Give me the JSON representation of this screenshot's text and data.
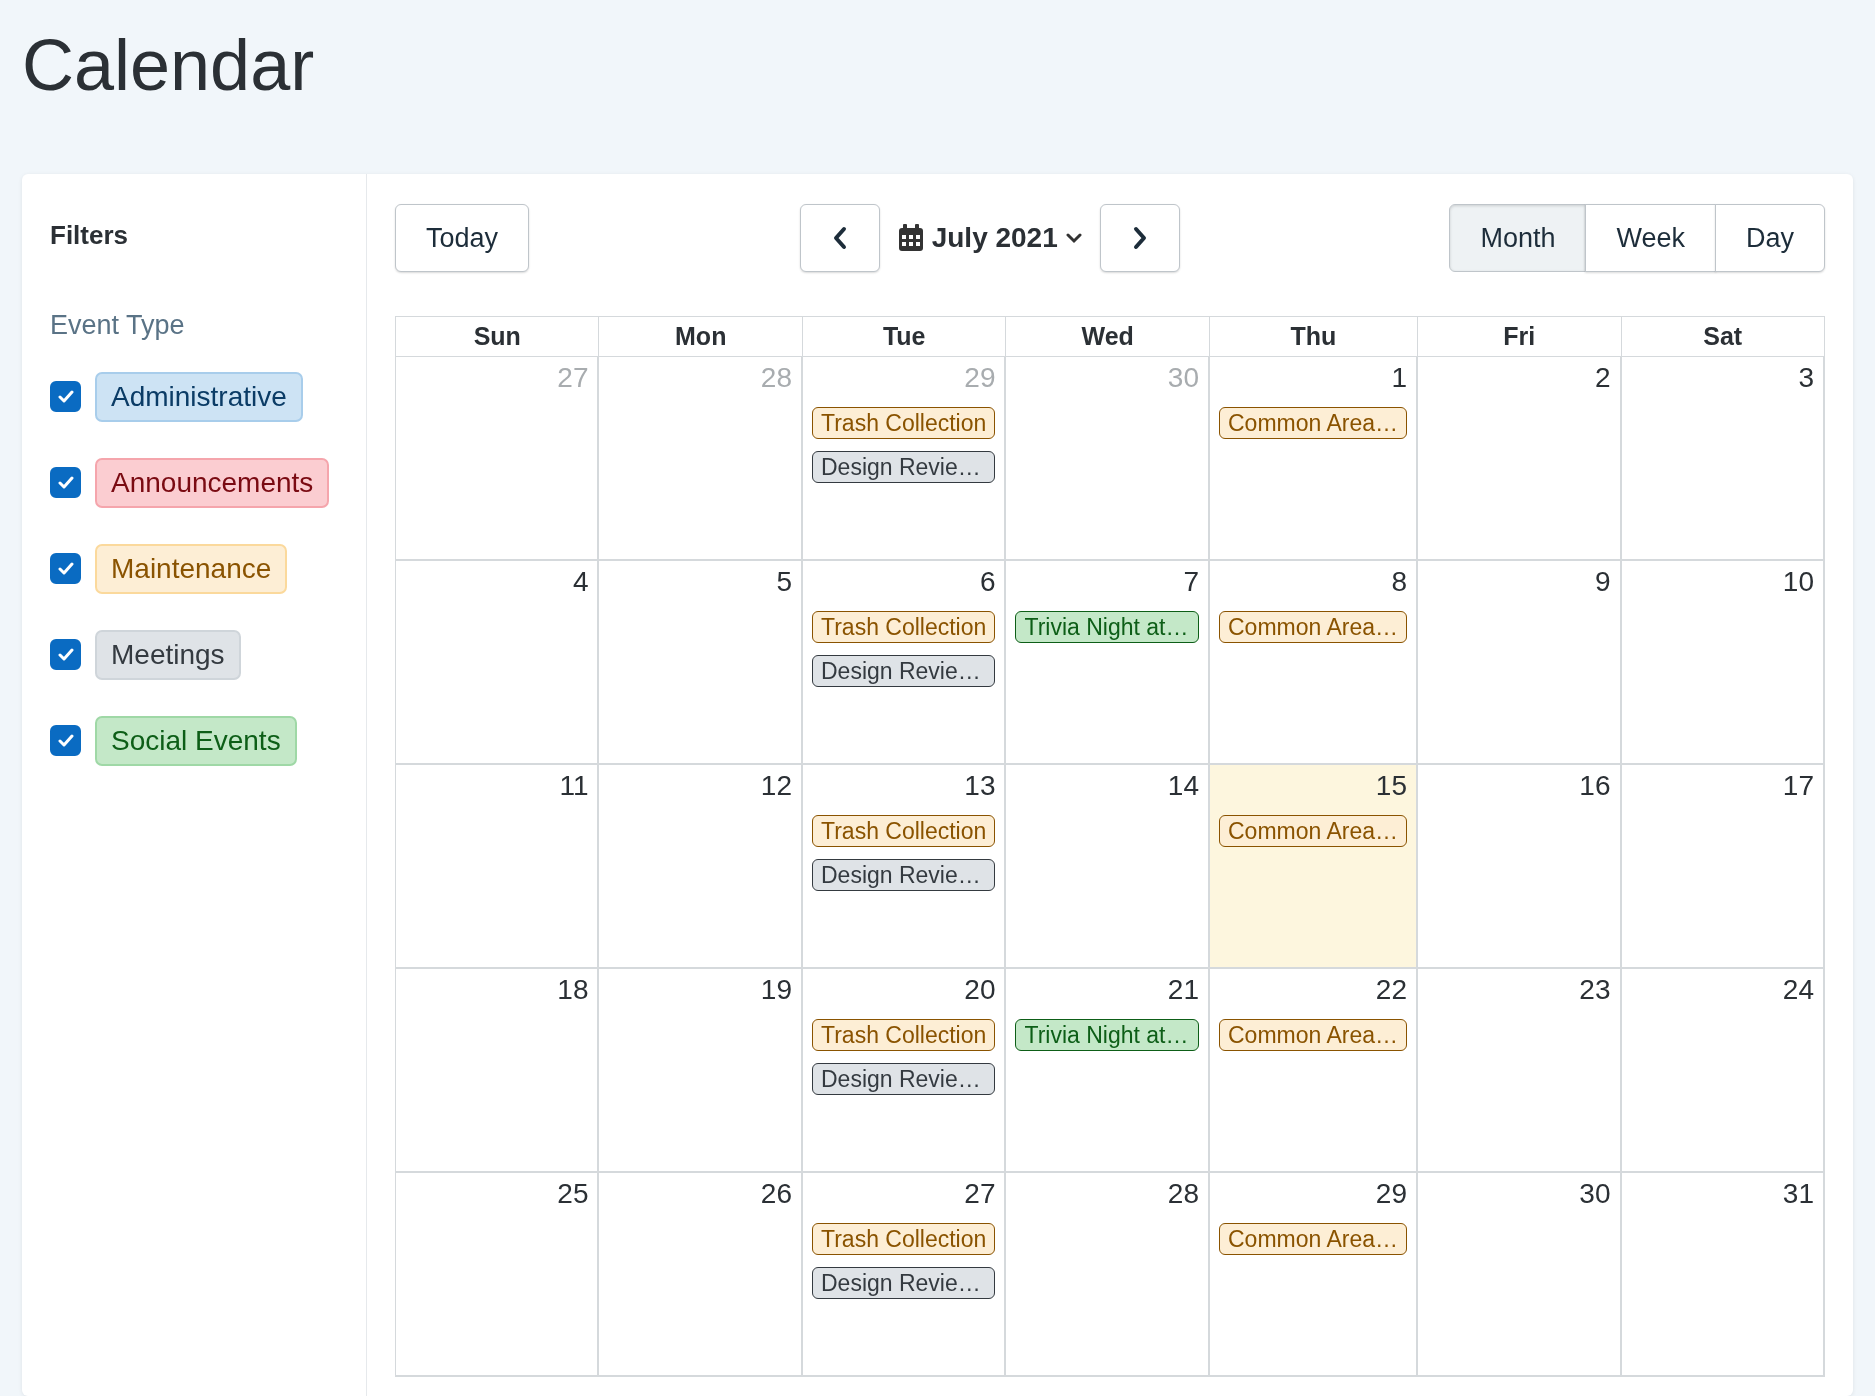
{
  "page_title": "Calendar",
  "filters": {
    "title": "Filters",
    "group_label": "Event Type",
    "items": [
      {
        "label": "Administrative",
        "kind": "administrative",
        "checked": true
      },
      {
        "label": "Announcements",
        "kind": "announcements",
        "checked": true
      },
      {
        "label": "Maintenance",
        "kind": "maintenance",
        "checked": true
      },
      {
        "label": "Meetings",
        "kind": "meetings",
        "checked": true
      },
      {
        "label": "Social Events",
        "kind": "social",
        "checked": true
      }
    ]
  },
  "toolbar": {
    "today": "Today",
    "month_label": "July 2021",
    "views": [
      {
        "label": "Month",
        "selected": true
      },
      {
        "label": "Week",
        "selected": false
      },
      {
        "label": "Day",
        "selected": false
      }
    ]
  },
  "weekdays": [
    "Sun",
    "Mon",
    "Tue",
    "Wed",
    "Thu",
    "Fri",
    "Sat"
  ],
  "weeks": [
    [
      {
        "day": "27",
        "outside": true,
        "today": false
      },
      {
        "day": "28",
        "outside": true,
        "today": false
      },
      {
        "day": "29",
        "outside": true,
        "today": false,
        "events": [
          {
            "title": "Trash Collection",
            "kind": "maintenance"
          },
          {
            "title": "Design Revie…",
            "kind": "meetings"
          }
        ]
      },
      {
        "day": "30",
        "outside": true,
        "today": false
      },
      {
        "day": "1",
        "outside": false,
        "today": false,
        "events": [
          {
            "title": "Common Area…",
            "kind": "maintenance"
          }
        ]
      },
      {
        "day": "2",
        "outside": false,
        "today": false
      },
      {
        "day": "3",
        "outside": false,
        "today": false
      }
    ],
    [
      {
        "day": "4",
        "outside": false,
        "today": false
      },
      {
        "day": "5",
        "outside": false,
        "today": false
      },
      {
        "day": "6",
        "outside": false,
        "today": false,
        "events": [
          {
            "title": "Trash Collection",
            "kind": "maintenance"
          },
          {
            "title": "Design Revie…",
            "kind": "meetings"
          }
        ]
      },
      {
        "day": "7",
        "outside": false,
        "today": false,
        "events": [
          {
            "title": "Trivia Night at…",
            "kind": "social"
          }
        ]
      },
      {
        "day": "8",
        "outside": false,
        "today": false,
        "events": [
          {
            "title": "Common Area…",
            "kind": "maintenance"
          }
        ]
      },
      {
        "day": "9",
        "outside": false,
        "today": false
      },
      {
        "day": "10",
        "outside": false,
        "today": false
      }
    ],
    [
      {
        "day": "11",
        "outside": false,
        "today": false
      },
      {
        "day": "12",
        "outside": false,
        "today": false
      },
      {
        "day": "13",
        "outside": false,
        "today": false,
        "events": [
          {
            "title": "Trash Collection",
            "kind": "maintenance"
          },
          {
            "title": "Design Revie…",
            "kind": "meetings"
          }
        ]
      },
      {
        "day": "14",
        "outside": false,
        "today": false
      },
      {
        "day": "15",
        "outside": false,
        "today": true,
        "events": [
          {
            "title": "Common Area…",
            "kind": "maintenance"
          }
        ]
      },
      {
        "day": "16",
        "outside": false,
        "today": false
      },
      {
        "day": "17",
        "outside": false,
        "today": false
      }
    ],
    [
      {
        "day": "18",
        "outside": false,
        "today": false
      },
      {
        "day": "19",
        "outside": false,
        "today": false
      },
      {
        "day": "20",
        "outside": false,
        "today": false,
        "events": [
          {
            "title": "Trash Collection",
            "kind": "maintenance"
          },
          {
            "title": "Design Revie…",
            "kind": "meetings"
          }
        ]
      },
      {
        "day": "21",
        "outside": false,
        "today": false,
        "events": [
          {
            "title": "Trivia Night at…",
            "kind": "social"
          }
        ]
      },
      {
        "day": "22",
        "outside": false,
        "today": false,
        "events": [
          {
            "title": "Common Area…",
            "kind": "maintenance"
          }
        ]
      },
      {
        "day": "23",
        "outside": false,
        "today": false
      },
      {
        "day": "24",
        "outside": false,
        "today": false
      }
    ],
    [
      {
        "day": "25",
        "outside": false,
        "today": false
      },
      {
        "day": "26",
        "outside": false,
        "today": false
      },
      {
        "day": "27",
        "outside": false,
        "today": false,
        "events": [
          {
            "title": "Trash Collection",
            "kind": "maintenance"
          },
          {
            "title": "Design Revie…",
            "kind": "meetings"
          }
        ]
      },
      {
        "day": "28",
        "outside": false,
        "today": false
      },
      {
        "day": "29",
        "outside": false,
        "today": false,
        "events": [
          {
            "title": "Common Area…",
            "kind": "maintenance"
          }
        ]
      },
      {
        "day": "30",
        "outside": false,
        "today": false
      },
      {
        "day": "31",
        "outside": false,
        "today": false
      }
    ]
  ]
}
